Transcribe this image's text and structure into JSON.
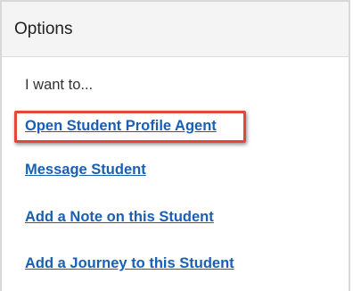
{
  "panel": {
    "title": "Options"
  },
  "intro_text": "I want to...",
  "options": [
    {
      "label": "Open Student Profile Agent",
      "highlighted": true
    },
    {
      "label": "Message Student"
    },
    {
      "label": "Add a Note on this Student"
    },
    {
      "label": "Add a Journey to this Student"
    }
  ],
  "colors": {
    "link": "#1a5fb4",
    "highlight_border": "#e5463a",
    "header_bg": "#f4f4f4"
  }
}
